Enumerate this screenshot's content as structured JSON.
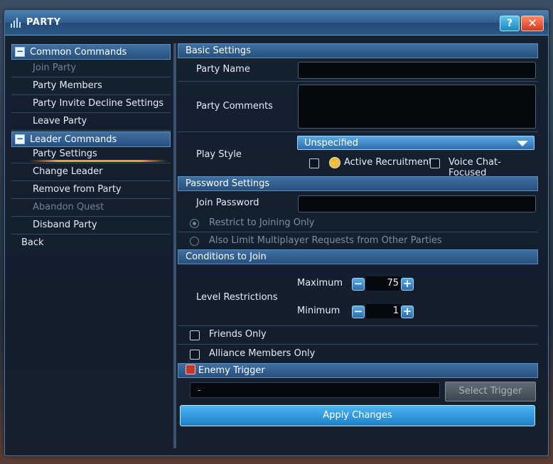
{
  "window": {
    "title": "PARTY",
    "help_label": "?",
    "close_label": "✕"
  },
  "sidebar": {
    "common_header": "Common Commands",
    "common_items": [
      {
        "label": "Join Party",
        "enabled": false
      },
      {
        "label": "Party Members",
        "enabled": true
      },
      {
        "label": "Party Invite Decline Settings",
        "enabled": true
      },
      {
        "label": "Leave Party",
        "enabled": true
      }
    ],
    "leader_header": "Leader Commands",
    "leader_items": [
      {
        "label": "Party Settings",
        "enabled": true,
        "active": true
      },
      {
        "label": "Change Leader",
        "enabled": true
      },
      {
        "label": "Remove from Party",
        "enabled": true
      },
      {
        "label": "Abandon Quest",
        "enabled": false
      },
      {
        "label": "Disband Party",
        "enabled": true
      }
    ],
    "back_label": "Back"
  },
  "basic_settings": {
    "header": "Basic Settings",
    "party_name_label": "Party Name",
    "party_name_value": "",
    "party_comments_label": "Party Comments",
    "party_comments_value": "",
    "play_style_label": "Play Style",
    "play_style_value": "Unspecified",
    "active_recruitment_label": "Active Recruitment",
    "voice_chat_label": "Voice Chat-Focused"
  },
  "password_settings": {
    "header": "Password Settings",
    "join_password_label": "Join Password",
    "join_password_value": "",
    "option_restrict": "Restrict to Joining Only",
    "option_limit": "Also Limit Multiplayer Requests from Other Parties"
  },
  "conditions": {
    "header": "Conditions to Join",
    "level_label": "Level Restrictions",
    "maximum_label": "Maximum",
    "maximum_value": "75",
    "minimum_label": "Minimum",
    "minimum_value": "1",
    "friends_only_label": "Friends Only",
    "alliance_only_label": "Alliance Members Only"
  },
  "enemy_trigger": {
    "header": "Enemy Trigger",
    "value": "-",
    "select_label": "Select Trigger"
  },
  "apply_label": "Apply Changes",
  "colors": {
    "accent_blue": "#2a6fb0",
    "highlight_orange": "#ffa11f",
    "close_red": "#d23a1e"
  }
}
